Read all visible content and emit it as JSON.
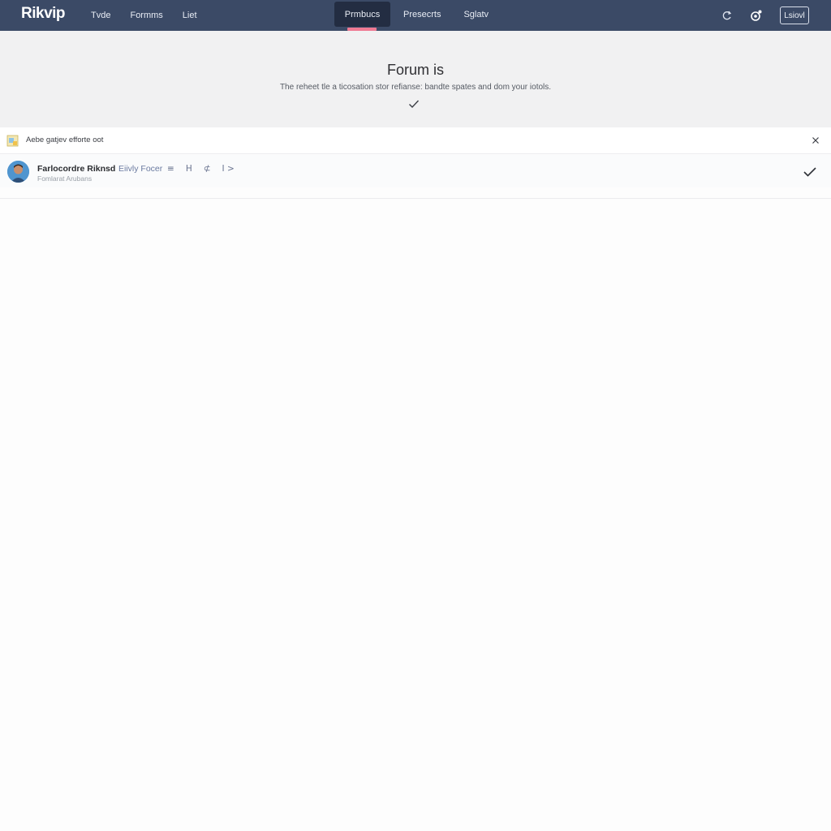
{
  "app": {
    "logo": "Rikvip"
  },
  "nav": {
    "left_links": [
      {
        "label": "Tvde"
      },
      {
        "label": "Formms"
      },
      {
        "label": "Liet"
      }
    ],
    "tabs": [
      {
        "label": "Prmbucs",
        "active": true
      },
      {
        "label": "Presecrts",
        "active": false
      },
      {
        "label": "Sglatv",
        "active": false
      }
    ],
    "right_button": "Lsiovl",
    "accent_color": "#ef7a93",
    "bar_color": "#3b4a66"
  },
  "hero": {
    "title": "Forum is",
    "subtitle": "The reheet tle a ticosation stor refianse: bandte spates and dom your iotols."
  },
  "notice": {
    "text": "Aebe gatjev efforte oot",
    "icon": "image-file-icon"
  },
  "post": {
    "author": "Farlocordre Riknsd",
    "forum": "Eiivly Focer",
    "subtitle": "Fomlarat Arubans",
    "tools": [
      "≡",
      "H",
      "⊄",
      "I >"
    ]
  }
}
